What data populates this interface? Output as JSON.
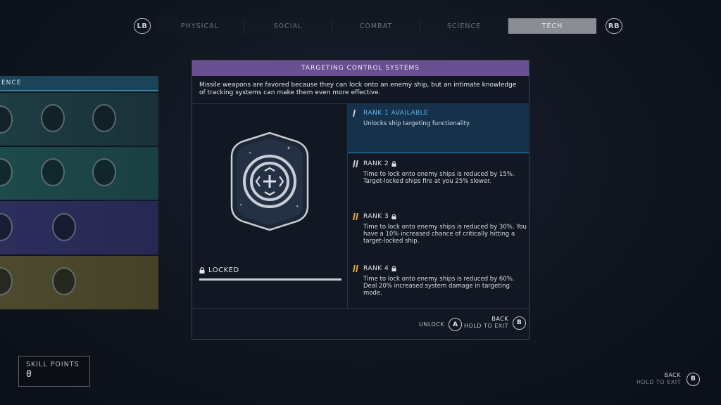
{
  "nav": {
    "left_bumper": "LB",
    "right_bumper": "RB",
    "tabs": [
      {
        "label": "PHYSICAL",
        "active": false
      },
      {
        "label": "SOCIAL",
        "active": false
      },
      {
        "label": "COMBAT",
        "active": false
      },
      {
        "label": "SCIENCE",
        "active": false
      },
      {
        "label": "TECH",
        "active": true
      }
    ]
  },
  "tree": {
    "header_label": "ENCE",
    "row_colors": [
      "#1f3d44",
      "#1d4a4c",
      "#2c2e5c",
      "#4d4a2e"
    ]
  },
  "skill": {
    "title": "TARGETING CONTROL SYSTEMS",
    "description": "Missile weapons are favored because they can lock onto an enemy ship, but an intimate knowledge of tracking systems can make them even more effective.",
    "status": "LOCKED",
    "ranks": [
      {
        "title": "RANK 1 AVAILABLE",
        "desc": "Unlocks ship targeting functionality.",
        "locked": false
      },
      {
        "title": "RANK 2",
        "desc": "Time to lock onto enemy ships is reduced by 15%. Target-locked ships fire at you 25% slower.",
        "locked": true
      },
      {
        "title": "RANK 3",
        "desc": "Time to lock onto enemy ships is reduced by 30%. You have a 10% increased chance of critically hitting a target-locked ship.",
        "locked": true
      },
      {
        "title": "RANK 4",
        "desc": "Time to lock onto enemy ships is reduced by 60%. Deal 20% increased system damage in targeting mode.",
        "locked": true
      }
    ]
  },
  "footer": {
    "unlock_label": "UNLOCK",
    "unlock_button": "A",
    "back_label": "BACK",
    "hold_label": "HOLD TO EXIT",
    "back_button": "B"
  },
  "skill_points": {
    "label": "SKILL POINTS",
    "value": "0"
  },
  "global_back": {
    "back_label": "BACK",
    "hold_label": "HOLD TO EXIT",
    "button": "B"
  },
  "colors": {
    "title_bar": "#6a4f93",
    "rank_available": "#5ab8ec",
    "rank_pip": "#e8a93a"
  }
}
